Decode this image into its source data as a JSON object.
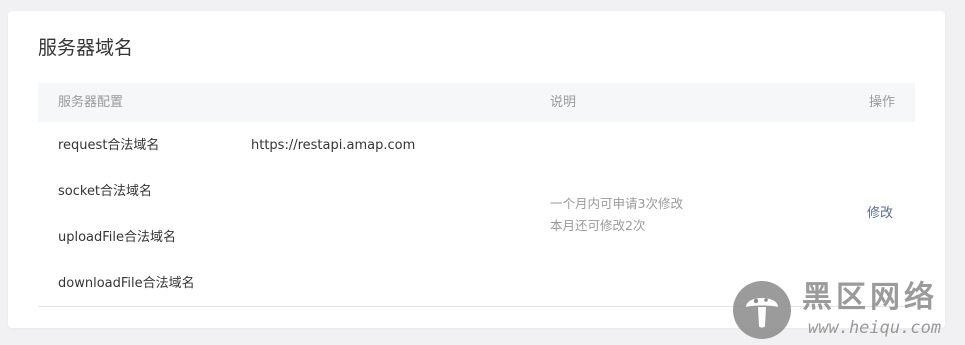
{
  "section": {
    "title": "服务器域名"
  },
  "table": {
    "headers": {
      "config": "服务器配置",
      "description": "说明",
      "operations": "操作"
    },
    "rows": [
      {
        "label": "request合法域名",
        "value": "https://restapi.amap.com"
      },
      {
        "label": "socket合法域名",
        "value": ""
      },
      {
        "label": "uploadFile合法域名",
        "value": ""
      },
      {
        "label": "downloadFile合法域名",
        "value": ""
      }
    ],
    "description_lines": [
      "一个月内可申请3次修改",
      "本月还可修改2次"
    ],
    "edit_label": "修改"
  },
  "watermark": {
    "chinese": "黑区网络",
    "domain": "www.heiqu.com"
  },
  "colors": {
    "link": "#576b95",
    "header_bg": "#f6f7f9",
    "muted_text": "#9a9a9a",
    "body_text": "#353535"
  }
}
